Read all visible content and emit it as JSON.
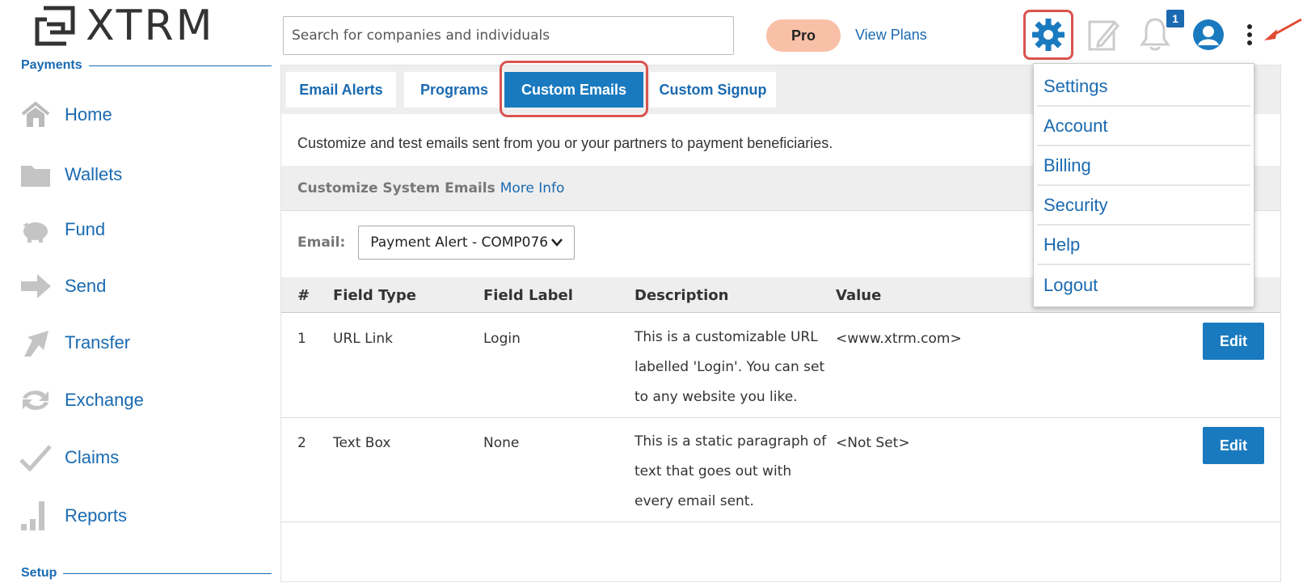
{
  "brand": {
    "name": "XTRM"
  },
  "sidebar": {
    "payments_heading": "Payments",
    "setup_heading": "Setup",
    "items": [
      {
        "label": "Home",
        "icon": "home-icon"
      },
      {
        "label": "Wallets",
        "icon": "folder-icon"
      },
      {
        "label": "Fund",
        "icon": "piggy-bank-icon"
      },
      {
        "label": "Send",
        "icon": "arrow-right-icon"
      },
      {
        "label": "Transfer",
        "icon": "diagonal-arrow-icon"
      },
      {
        "label": "Exchange",
        "icon": "exchange-icon"
      },
      {
        "label": "Claims",
        "icon": "checkmark-icon"
      },
      {
        "label": "Reports",
        "icon": "bar-chart-icon"
      }
    ]
  },
  "topbar": {
    "search_placeholder": "Search for companies and individuals",
    "plan_badge": "Pro",
    "view_plans": "View Plans",
    "notification_count": "1"
  },
  "tabs": [
    {
      "label": "Email Alerts",
      "active": false
    },
    {
      "label": "Programs",
      "active": false
    },
    {
      "label": "Custom Emails",
      "active": true
    },
    {
      "label": "Custom Signup",
      "active": false
    }
  ],
  "main": {
    "intro": "Customize and test emails sent from you or your partners to payment beneficiaries.",
    "sub_heading": "Customize System Emails",
    "more_info": "More Info",
    "email_label": "Email:",
    "email_selected": "Payment Alert - COMP076"
  },
  "table": {
    "headers": [
      "#",
      "Field Type",
      "Field Label",
      "Description",
      "Value"
    ],
    "rows": [
      {
        "num": "1",
        "type": "URL Link",
        "label": "Login",
        "desc": "This is a customizable URL labelled 'Login'. You can set to any website you like.",
        "value": "<www.xtrm.com>",
        "action": "Edit"
      },
      {
        "num": "2",
        "type": "Text Box",
        "label": "None",
        "desc": "This is a static paragraph of text that goes out with every email sent.",
        "value": "<Not Set>",
        "action": "Edit"
      }
    ]
  },
  "dropdown_menu": [
    "Settings",
    "Account",
    "Billing",
    "Security",
    "Help",
    "Logout"
  ],
  "colors": {
    "accent": "#1a6ab1",
    "active_tab": "#1a7abf",
    "highlight_outline": "#d9534f",
    "pro_badge": "#f9c0a8"
  }
}
